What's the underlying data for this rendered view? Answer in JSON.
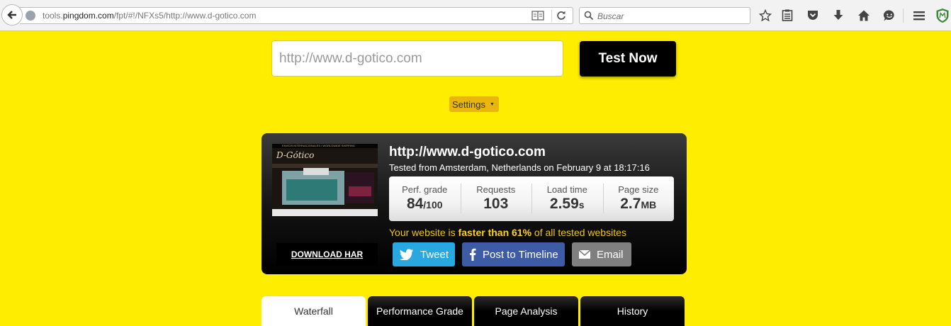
{
  "browser": {
    "url_prefix": "tools.",
    "url_host": "pingdom.com",
    "url_rest": "/fpt/#!/NFXs5/http://www.d-gotico.com",
    "search_placeholder": "Buscar"
  },
  "form": {
    "url_placeholder": "http://www.d-gotico.com",
    "test_button": "Test Now",
    "settings_label": "Settings"
  },
  "result": {
    "site_url": "http://www.d-gotico.com",
    "tested_from": "Tested from Amsterdam, Netherlands on February 9 at 18:17:16",
    "thumbnail": {
      "top_text": "ENVÍOS INTERNACIONALES / WORLDWIDE SHIPPING",
      "logo": "D-Gótico"
    },
    "stats": [
      {
        "label": "Perf. grade",
        "value": "84",
        "unit": "/100"
      },
      {
        "label": "Requests",
        "value": "103",
        "unit": ""
      },
      {
        "label": "Load time",
        "value": "2.59",
        "unit": "s"
      },
      {
        "label": "Page size",
        "value": "2.7",
        "unit": "MB"
      }
    ],
    "faster_prefix": "Your website is ",
    "faster_bold": "faster than 61%",
    "faster_suffix": " of all tested websites",
    "download_har": "DOWNLOAD HAR",
    "share": {
      "tweet": "Tweet",
      "facebook": "Post to Timeline",
      "email": "Email"
    }
  },
  "tabs": [
    {
      "label": "Waterfall",
      "active": true
    },
    {
      "label": "Performance Grade",
      "active": false
    },
    {
      "label": "Page Analysis",
      "active": false
    },
    {
      "label": "History",
      "active": false
    }
  ],
  "colors": {
    "page_background": "#ffed00",
    "settings_button": "#e8b60c",
    "twitter": "#27a8e0",
    "facebook": "#3e5ba6",
    "email": "#7f7f7f",
    "highlight_text": "#f0c60a"
  }
}
